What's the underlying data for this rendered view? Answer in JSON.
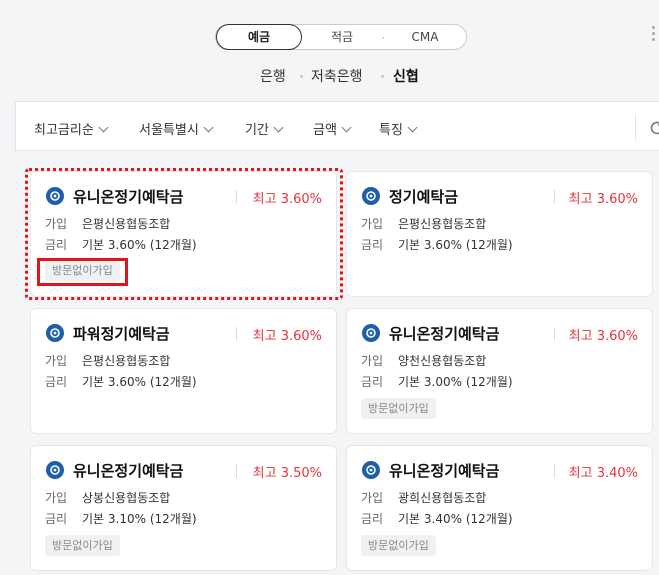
{
  "tabs": [
    {
      "label": "예금",
      "active": true
    },
    {
      "label": "적금",
      "active": false
    },
    {
      "label": "CMA",
      "active": false
    }
  ],
  "institutions": [
    {
      "label": "은행",
      "active": false
    },
    {
      "label": "저축은행",
      "active": false
    },
    {
      "label": "신협",
      "active": true
    }
  ],
  "filters": [
    {
      "label": "최고금리순"
    },
    {
      "label": "서울특별시"
    },
    {
      "label": "기간"
    },
    {
      "label": "금액"
    },
    {
      "label": "특징"
    }
  ],
  "labels": {
    "join": "가입",
    "rate": "금리"
  },
  "products": [
    {
      "name": "유니온정기예탁금",
      "rate": "최고 3.60%",
      "join": "은평신용협동조합",
      "base": "기본 3.60% (12개월)",
      "badge": "방문없이가입"
    },
    {
      "name": "정기예탁금",
      "rate": "최고 3.60%",
      "join": "은평신용협동조합",
      "base": "기본 3.60% (12개월)",
      "badge": ""
    },
    {
      "name": "파워정기예탁금",
      "rate": "최고 3.60%",
      "join": "은평신용협동조합",
      "base": "기본 3.60% (12개월)",
      "badge": ""
    },
    {
      "name": "유니온정기예탁금",
      "rate": "최고 3.60%",
      "join": "양천신용협동조합",
      "base": "기본 3.00% (12개월)",
      "badge": "방문없이가입"
    },
    {
      "name": "유니온정기예탁금",
      "rate": "최고 3.50%",
      "join": "상봉신용협동조합",
      "base": "기본 3.10% (12개월)",
      "badge": "방문없이가입"
    },
    {
      "name": "유니온정기예탁금",
      "rate": "최고 3.40%",
      "join": "광희신용협동조합",
      "base": "기본 3.40% (12개월)",
      "badge": "방문없이가입"
    }
  ],
  "colors": {
    "rate": "#e2343f",
    "highlight": "#e3141b",
    "icon": "#1d5fa8"
  }
}
